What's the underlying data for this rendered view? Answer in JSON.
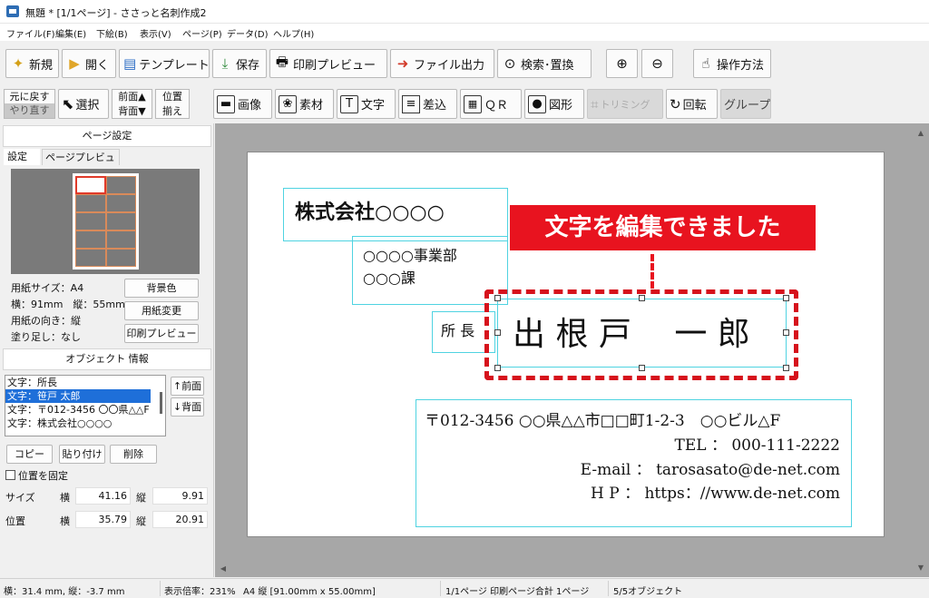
{
  "window": {
    "title": "無題 * [1/1ページ] - ささっと名刺作成2"
  },
  "menu": [
    "ファイル(F)",
    "編集(E)",
    "下絵(B)",
    "表示(V)",
    "ページ(P)",
    "データ(D)",
    "ヘルプ(H)"
  ],
  "toolbar1": {
    "new": "新規",
    "open": "開く",
    "template": "テンプレート",
    "save": "保存",
    "print_preview": "印刷プレビュー",
    "file_output": "ファイル出力",
    "search_replace": "検索･置換",
    "how_to": "操作方法"
  },
  "toolbar2": {
    "undo": "元に戻す",
    "redo": "やり直す",
    "select": "選択",
    "front": "前面▲",
    "back": "背面▼",
    "align_top": "位置",
    "align_bottom": "揃え",
    "image": "画像",
    "material": "素材",
    "text": "文字",
    "merge": "差込",
    "qr": "ＱＲ",
    "shape": "図形",
    "trimming": "トリミング",
    "rotate": "回転",
    "group": "グループ"
  },
  "page_settings": {
    "header": "ページ設定",
    "tab_settings": "設定",
    "tab_preview": "ページプレビュー",
    "paper_size": "用紙サイズ：A4",
    "dims": "横：91mm　縦：55mm",
    "orientation": "用紙の向き：縦",
    "bleed": "塗り足し：なし",
    "bg_color_button": "背景色",
    "change_paper_button": "用紙変更",
    "print_preview_button": "印刷プレビュー"
  },
  "object_info": {
    "header": "オブジェクト 情報",
    "items": [
      "文字：所長",
      "文字：笹戸 太郎",
      "文字：〒012-3456 〇〇県△△F",
      "文字：株式会社○○○○"
    ],
    "selected_index": 1,
    "front_button": "↑前面",
    "back_button": "↓背面",
    "copy_button": "コピー",
    "paste_button": "貼り付け",
    "delete_button": "削除",
    "fix_position_label": "位置を固定",
    "size_label": "サイズ",
    "position_label": "位置",
    "w_label": "横",
    "h_label": "縦",
    "size_w": "41.16",
    "size_h": "9.91",
    "pos_x": "35.79",
    "pos_y": "20.91"
  },
  "card": {
    "company": "株式会社○○○○",
    "dept1": "○○○○事業部",
    "dept2": "○○○課",
    "title": "所 長",
    "name": "出 根 戸　 一 郎",
    "address": "〒012-3456 ○○県△△市□□町1-2-3　○○ビル△F",
    "tel": "TEL ： 000-111-2222",
    "email": "E-mail ： tarosasato@de-net.com",
    "hp": "H P ： https：//www.de-net.com",
    "callout": "文字を編集できました",
    "callout_color": "#e8131f"
  },
  "status": {
    "cursor": "横：31.4 mm, 縦：-3.7 mm",
    "zoom": "表示倍率：231%",
    "paper": "A4 縦 [91.00mm x 55.00mm]",
    "pages": "1/1ページ 印刷ページ合計 1ページ",
    "objects": "5/5オブジェクト"
  }
}
